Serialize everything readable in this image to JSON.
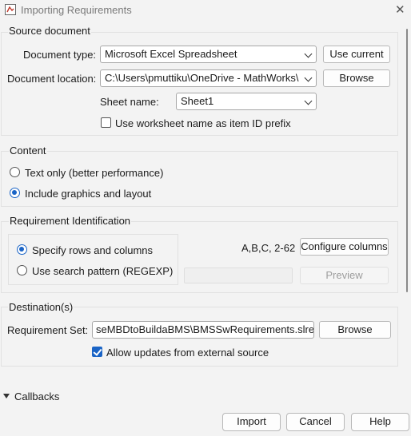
{
  "window": {
    "title": "Importing Requirements",
    "app_icon": "matlab-dialog-icon",
    "close_icon": "close-icon"
  },
  "source_document": {
    "legend": "Source document",
    "document_type_label": "Document type:",
    "document_type_value": "Microsoft Excel Spreadsheet",
    "use_current_label": "Use current",
    "document_location_label": "Document location:",
    "document_location_value": "C:\\Users\\pmuttiku\\OneDrive - MathWorks\\",
    "browse_label": "Browse",
    "sheet_name_label": "Sheet name:",
    "sheet_name_value": "Sheet1",
    "prefix_checkbox_label": "Use worksheet name as item ID prefix",
    "prefix_checked": false
  },
  "content": {
    "legend": "Content",
    "option_text_only": "Text only (better performance)",
    "option_graphics": "Include graphics and layout",
    "selected": "graphics"
  },
  "requirement_identification": {
    "legend": "Requirement Identification",
    "option_rows_columns": "Specify rows and columns",
    "option_search_pattern": "Use search pattern (REGEXP)",
    "selected": "rows_columns",
    "columns_value": "A,B,C, 2-62",
    "configure_columns_label": "Configure columns",
    "preview_label": "Preview"
  },
  "destination": {
    "legend": "Destination(s)",
    "requirement_set_label": "Requirement Set:",
    "requirement_set_value": "seMBDtoBuildaBMS\\BMSSwRequirements.slreqx",
    "browse_label": "Browse",
    "allow_updates_label": "Allow updates from external source",
    "allow_updates_checked": true
  },
  "callbacks": {
    "label": "Callbacks",
    "icon": "triangle-down-icon"
  },
  "footer": {
    "import_label": "Import",
    "cancel_label": "Cancel",
    "help_label": "Help"
  },
  "colors": {
    "accent": "#1a64c6",
    "background": "#f3f3f3"
  }
}
